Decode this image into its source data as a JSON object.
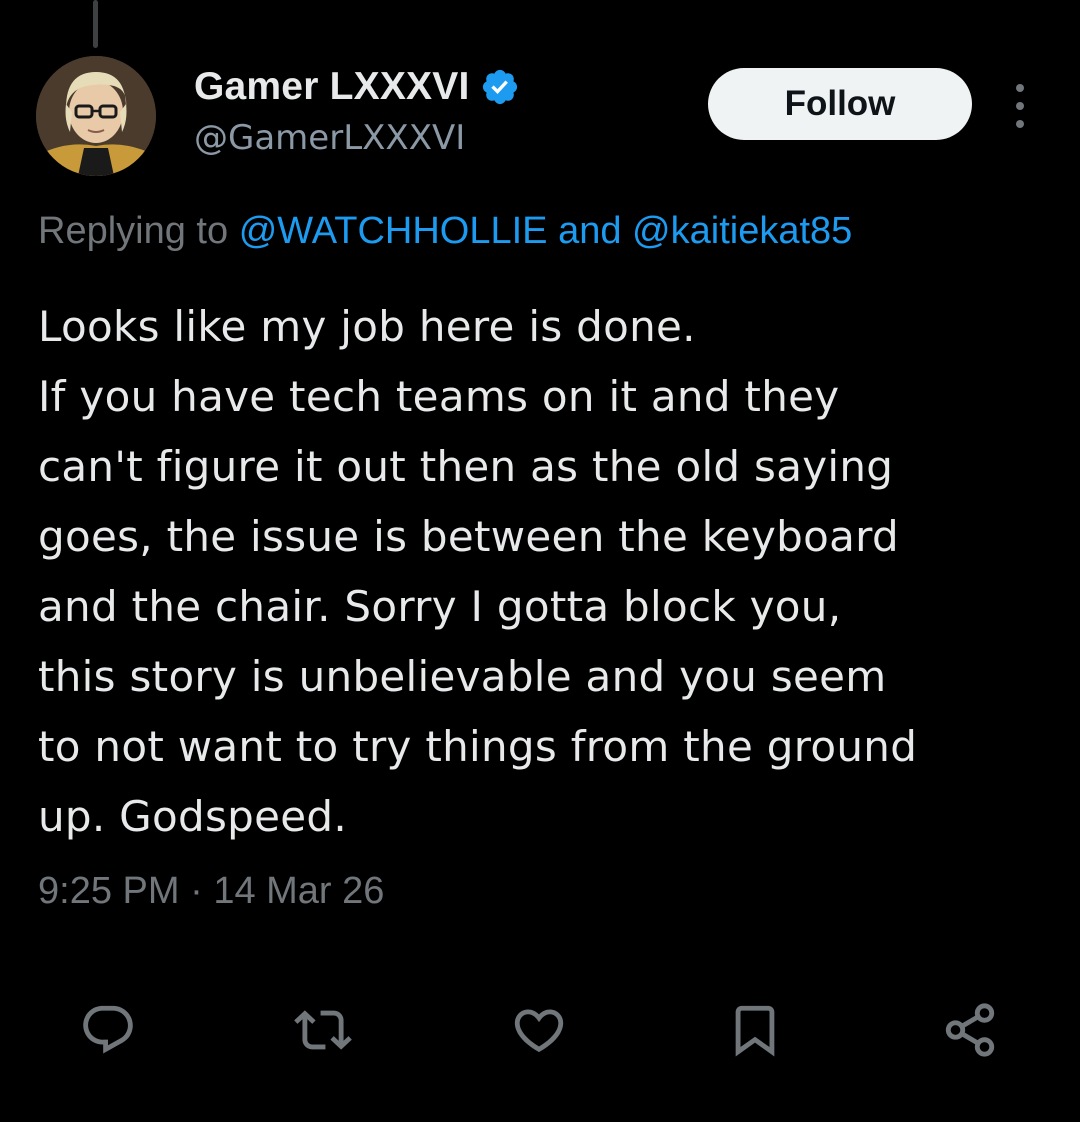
{
  "author": {
    "display_name": "Gamer LXXXVI",
    "handle": "@GamerLXXXVI",
    "verified": true
  },
  "follow_label": "Follow",
  "reply_context": {
    "prefix": "Replying to",
    "mention_1": "@WATCHHOLLIE",
    "joiner": "and",
    "mention_2": "@kaitiekat85"
  },
  "tweet_lines": [
    "Looks like my job here is done.",
    "If you have tech teams on it and they",
    "can't figure it out then as the old saying",
    "goes, the issue is between the keyboard",
    "and the chair. Sorry I gotta block you,",
    "this story is unbelievable and you seem",
    "to not want to try things from the ground",
    "up. Godspeed."
  ],
  "timestamp": {
    "time": "9:25 PM",
    "separator": "·",
    "date": "14 Mar 26"
  },
  "actions": [
    "reply-icon",
    "repost-icon",
    "like-icon",
    "bookmark-icon",
    "share-icon"
  ],
  "colors": {
    "background": "#000000",
    "text": "#e7e9ea",
    "secondary": "#71767b",
    "link": "#1d9bf0",
    "verified": "#1d9bf0"
  }
}
